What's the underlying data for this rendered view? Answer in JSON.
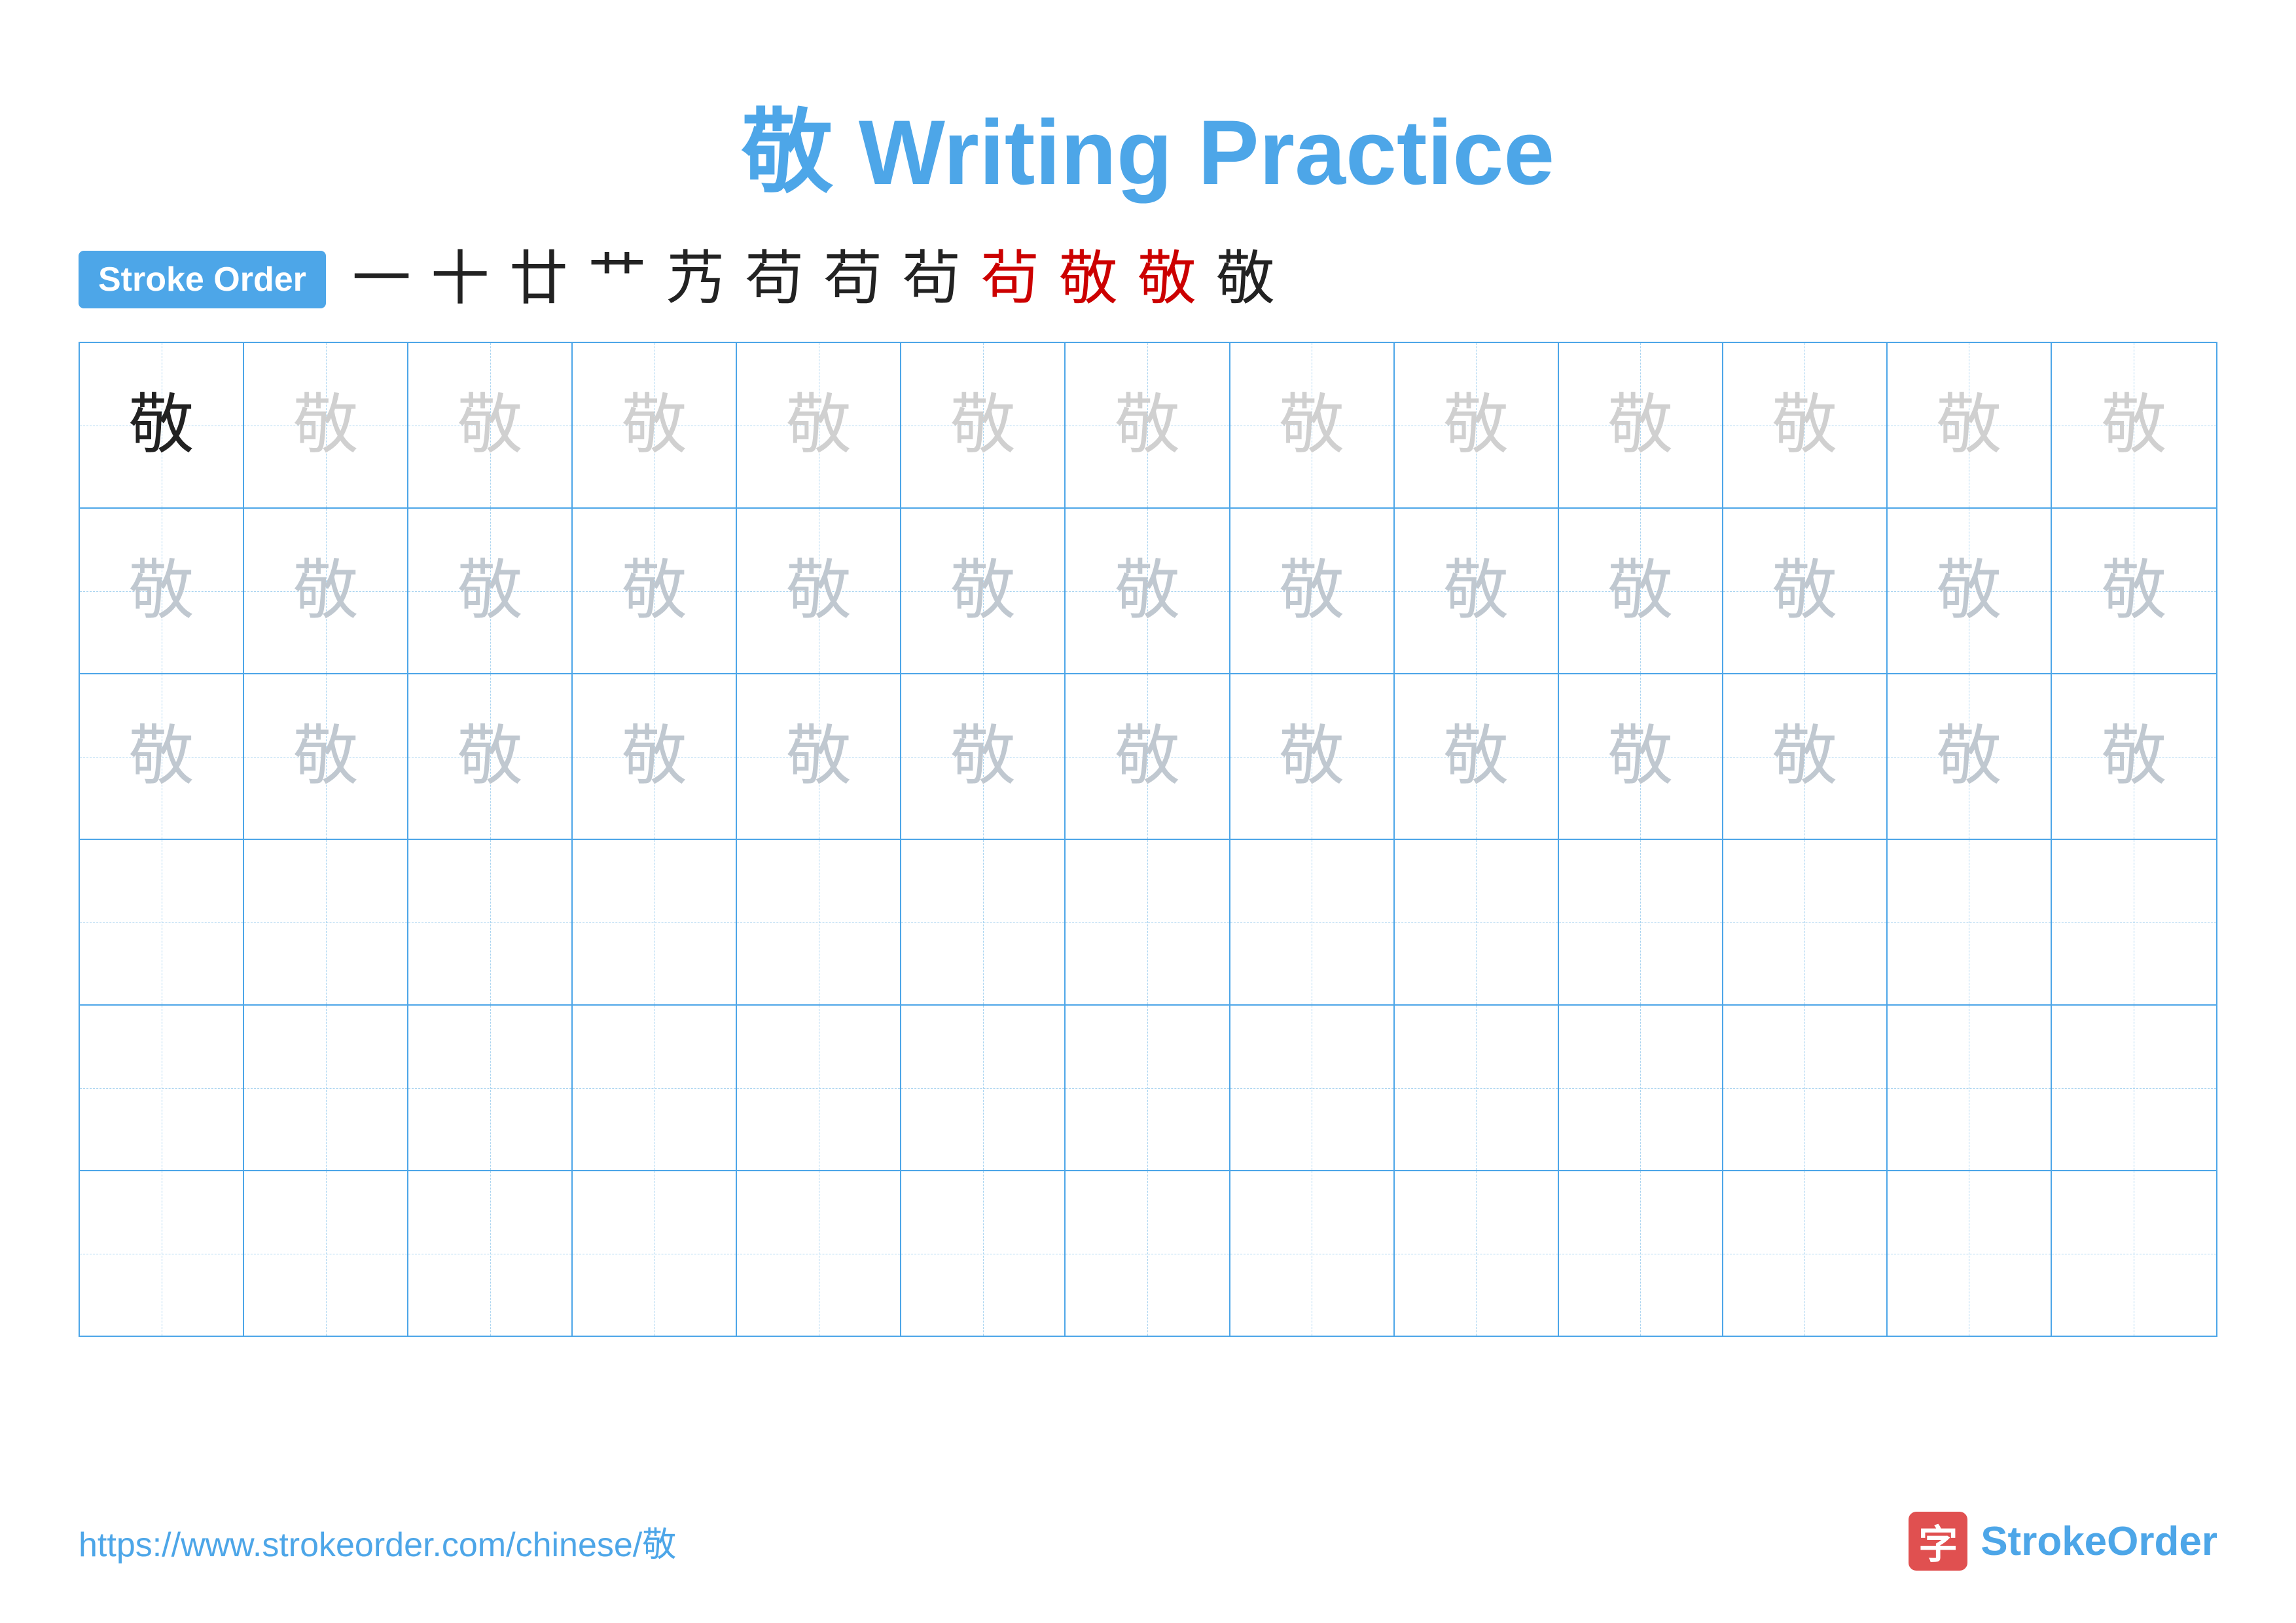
{
  "title": {
    "char": "敬",
    "text": "Writing Practice",
    "full": "敬 Writing Practice"
  },
  "stroke_order": {
    "badge_label": "Stroke Order",
    "strokes": [
      "一",
      "十",
      "廿",
      "艹",
      "艿",
      "苟",
      "苟",
      "茍",
      "茍",
      "敬",
      "敬",
      "敬"
    ]
  },
  "grid": {
    "rows": [
      {
        "type": "example",
        "cells": [
          {
            "char": "敬",
            "style": "dark"
          },
          {
            "char": "敬",
            "style": "light"
          },
          {
            "char": "敬",
            "style": "light"
          },
          {
            "char": "敬",
            "style": "light"
          },
          {
            "char": "敬",
            "style": "light"
          },
          {
            "char": "敬",
            "style": "light"
          },
          {
            "char": "敬",
            "style": "light"
          },
          {
            "char": "敬",
            "style": "light"
          },
          {
            "char": "敬",
            "style": "light"
          },
          {
            "char": "敬",
            "style": "light"
          },
          {
            "char": "敬",
            "style": "light"
          },
          {
            "char": "敬",
            "style": "light"
          },
          {
            "char": "敬",
            "style": "light"
          }
        ]
      },
      {
        "type": "practice",
        "cells": [
          {
            "char": "敬",
            "style": "medium"
          },
          {
            "char": "敬",
            "style": "medium"
          },
          {
            "char": "敬",
            "style": "medium"
          },
          {
            "char": "敬",
            "style": "medium"
          },
          {
            "char": "敬",
            "style": "medium"
          },
          {
            "char": "敬",
            "style": "medium"
          },
          {
            "char": "敬",
            "style": "medium"
          },
          {
            "char": "敬",
            "style": "medium"
          },
          {
            "char": "敬",
            "style": "medium"
          },
          {
            "char": "敬",
            "style": "medium"
          },
          {
            "char": "敬",
            "style": "medium"
          },
          {
            "char": "敬",
            "style": "medium"
          },
          {
            "char": "敬",
            "style": "medium"
          }
        ]
      },
      {
        "type": "practice",
        "cells": [
          {
            "char": "敬",
            "style": "medium"
          },
          {
            "char": "敬",
            "style": "medium"
          },
          {
            "char": "敬",
            "style": "medium"
          },
          {
            "char": "敬",
            "style": "medium"
          },
          {
            "char": "敬",
            "style": "medium"
          },
          {
            "char": "敬",
            "style": "medium"
          },
          {
            "char": "敬",
            "style": "medium"
          },
          {
            "char": "敬",
            "style": "medium"
          },
          {
            "char": "敬",
            "style": "medium"
          },
          {
            "char": "敬",
            "style": "medium"
          },
          {
            "char": "敬",
            "style": "medium"
          },
          {
            "char": "敬",
            "style": "medium"
          },
          {
            "char": "敬",
            "style": "medium"
          }
        ]
      },
      {
        "type": "empty",
        "cells": [
          "",
          "",
          "",
          "",
          "",
          "",
          "",
          "",
          "",
          "",
          "",
          "",
          ""
        ]
      },
      {
        "type": "empty",
        "cells": [
          "",
          "",
          "",
          "",
          "",
          "",
          "",
          "",
          "",
          "",
          "",
          "",
          ""
        ]
      },
      {
        "type": "empty",
        "cells": [
          "",
          "",
          "",
          "",
          "",
          "",
          "",
          "",
          "",
          "",
          "",
          "",
          ""
        ]
      }
    ]
  },
  "footer": {
    "url": "https://www.strokeorder.com/chinese/敬",
    "logo_char": "字",
    "logo_name": "StrokeOrder"
  }
}
